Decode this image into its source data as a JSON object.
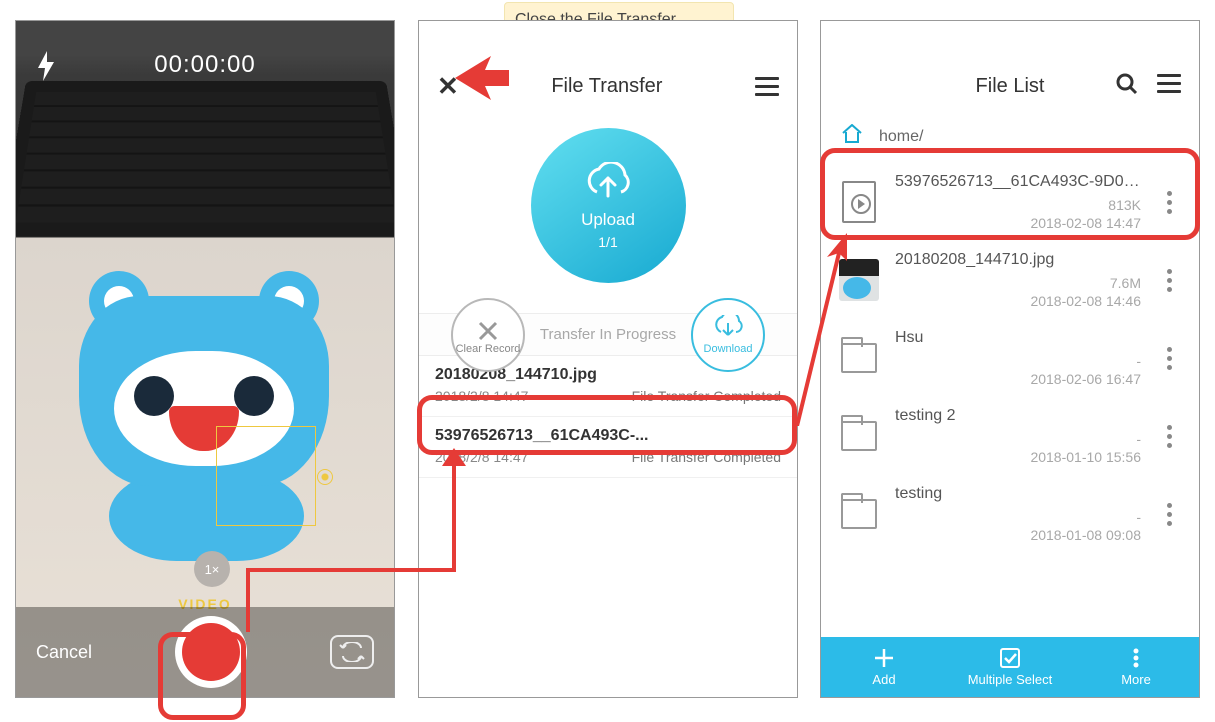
{
  "callout": "Close the File Transfer window to review the file.",
  "camera": {
    "timer": "00:00:00",
    "mode": "VIDEO",
    "cancel": "Cancel",
    "zoom": "1×"
  },
  "file_transfer": {
    "title": "File Transfer",
    "upload_label": "Upload",
    "upload_count": "1/1",
    "clear_record": "Clear Record",
    "download": "Download",
    "section": "Transfer In Progress",
    "items": [
      {
        "name": "20180208_144710.jpg",
        "time": "2018/2/8 14:47",
        "status": "File Transfer Completed"
      },
      {
        "name": "53976526713__61CA493C-...",
        "time": "2018/2/8 14:47",
        "status": "File Transfer Completed"
      }
    ]
  },
  "file_list": {
    "title": "File List",
    "path": "home/",
    "items": [
      {
        "type": "video",
        "name": "53976526713__61CA493C-9D02...",
        "size": "813K",
        "date": "2018-02-08 14:47"
      },
      {
        "type": "photo",
        "name": "20180208_144710.jpg",
        "size": "7.6M",
        "date": "2018-02-08 14:46"
      },
      {
        "type": "folder",
        "name": "Hsu",
        "size": "-",
        "date": "2018-02-06 16:47"
      },
      {
        "type": "folder",
        "name": "testing 2",
        "size": "-",
        "date": "2018-01-10 15:56"
      },
      {
        "type": "folder",
        "name": "testing",
        "size": "-",
        "date": "2018-01-08 09:08"
      }
    ],
    "bottom": {
      "add": "Add",
      "multi": "Multiple Select",
      "more": "More"
    }
  }
}
